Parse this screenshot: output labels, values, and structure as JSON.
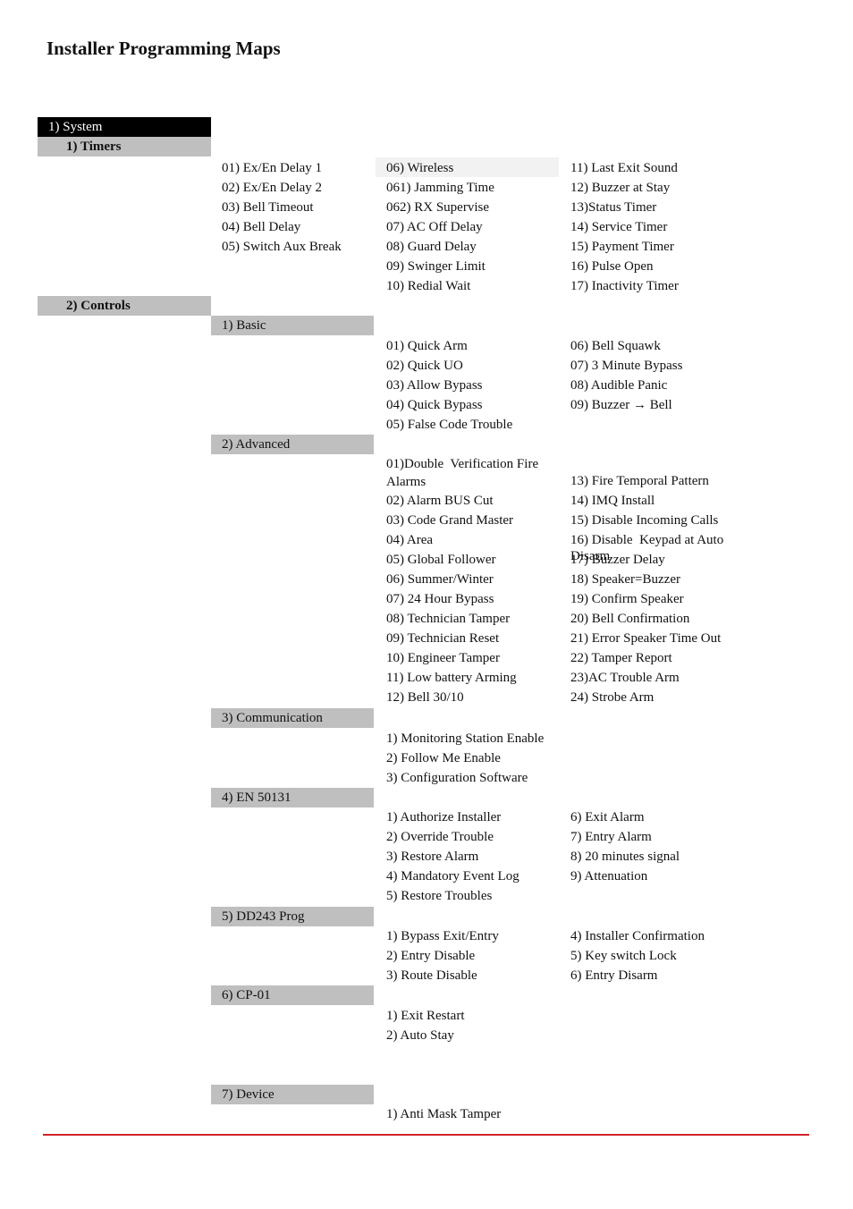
{
  "title": "Installer Programming Maps",
  "colors": {
    "system_bg": "#000000",
    "header_bg": "#bfbfbf",
    "highlight_bg": "#f2f2f2",
    "rule": "#d2232a"
  },
  "system": {
    "label": "1) System"
  },
  "timers": {
    "label": "1) Timers",
    "col1": [
      "01) Ex/En Delay 1",
      "02) Ex/En Delay 2",
      "03) Bell Timeout",
      "04) Bell Delay",
      "05) Switch Aux Break"
    ],
    "col2": [
      "06) Wireless",
      "061) Jamming Time",
      "062) RX Supervise",
      "07) AC Off Delay",
      "08) Guard Delay",
      "09) Swinger Limit",
      "10) Redial Wait"
    ],
    "col3": [
      "11) Last Exit Sound",
      "12) Buzzer at Stay",
      "13)Status Timer",
      "14) Service Timer",
      "15) Payment Timer",
      "16) Pulse Open",
      "17) Inactivity Timer"
    ]
  },
  "controls": {
    "label": "2) Controls",
    "sections": [
      {
        "label": "1) Basic",
        "col2": [
          "01) Quick Arm",
          "02) Quick UO",
          "03) Allow Bypass",
          "04) Quick Bypass",
          "05) False Code Trouble"
        ],
        "col3": [
          "06) Bell Squawk",
          "07) 3 Minute Bypass",
          "08) Audible Panic",
          "09) Buzzer → Bell"
        ]
      },
      {
        "label": "2) Advanced",
        "col2": [
          "01)Double  Verification Fire Alarms",
          "02) Alarm BUS Cut",
          "03) Code Grand Master",
          "04) Area",
          "05) Global Follower",
          "06) Summer/Winter",
          "07) 24 Hour Bypass",
          "08) Technician Tamper",
          "09) Technician Reset",
          "10) Engineer Tamper",
          "11) Low battery Arming",
          "12) Bell 30/10"
        ],
        "col3": [
          "13) Fire Temporal Pattern",
          "14) IMQ Install",
          "15) Disable Incoming Calls",
          "16) Disable  Keypad at Auto Disarm",
          "17) Buzzer Delay",
          "18) Speaker=Buzzer",
          "19) Confirm Speaker",
          "20) Bell Confirmation",
          "21) Error Speaker Time Out",
          "22) Tamper Report",
          "23)AC Trouble Arm",
          "24) Strobe Arm"
        ]
      },
      {
        "label": "3) Communication",
        "col2": [
          "1) Monitoring Station Enable",
          "2) Follow Me Enable",
          "3) Configuration Software"
        ],
        "col3": []
      },
      {
        "label": "4) EN 50131",
        "col2": [
          "1) Authorize Installer",
          "2) Override Trouble",
          "3) Restore Alarm",
          "4) Mandatory Event Log",
          "5) Restore Troubles"
        ],
        "col3": [
          "6) Exit Alarm",
          "7) Entry Alarm",
          "8) 20 minutes signal",
          "9) Attenuation"
        ]
      },
      {
        "label": "5) DD243 Prog",
        "col2": [
          "1) Bypass Exit/Entry",
          "2) Entry Disable",
          "3) Route Disable"
        ],
        "col3": [
          "4) Installer Confirmation",
          "5) Key switch Lock",
          "6) Entry Disarm"
        ]
      },
      {
        "label": "6) CP-01",
        "col2": [
          "1) Exit Restart",
          "2) Auto Stay"
        ],
        "col3": []
      },
      {
        "label": "7) Device",
        "col2": [
          "1) Anti Mask Tamper"
        ],
        "col3": []
      }
    ]
  }
}
